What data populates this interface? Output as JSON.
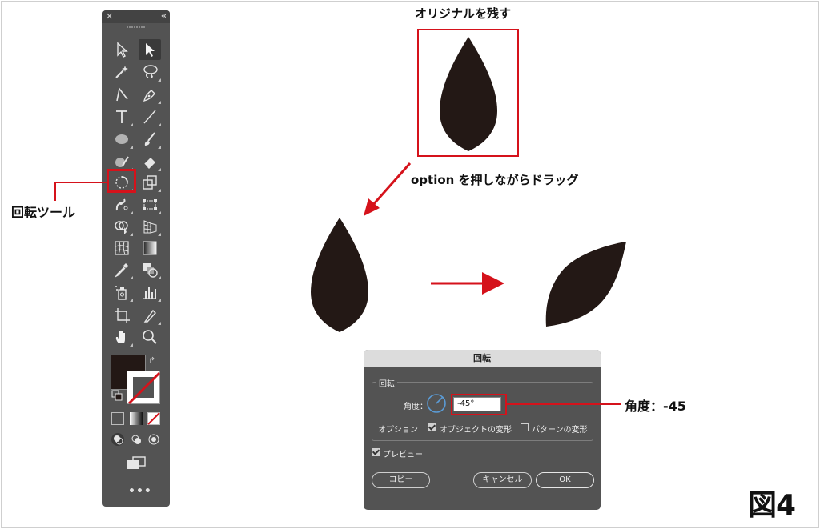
{
  "tools_panel": {
    "close_glyph": "✕",
    "collapse_glyph": "«",
    "more_glyph": "•••",
    "tools": [
      {
        "icon": "direct-selection-icon"
      },
      {
        "icon": "selection-icon"
      },
      {
        "icon": "magic-wand-icon"
      },
      {
        "icon": "lasso-icon"
      },
      {
        "icon": "curvature-icon"
      },
      {
        "icon": "pen-icon"
      },
      {
        "icon": "type-icon"
      },
      {
        "icon": "line-icon"
      },
      {
        "icon": "ellipse-icon"
      },
      {
        "icon": "paintbrush-icon"
      },
      {
        "icon": "shaper-icon"
      },
      {
        "icon": "eraser-icon"
      },
      {
        "icon": "rotate-icon"
      },
      {
        "icon": "scale-icon"
      },
      {
        "icon": "puppet-warp-icon"
      },
      {
        "icon": "free-transform-icon"
      },
      {
        "icon": "shape-builder-icon"
      },
      {
        "icon": "perspective-grid-icon"
      },
      {
        "icon": "mesh-icon"
      },
      {
        "icon": "gradient-icon"
      },
      {
        "icon": "eyedropper-icon"
      },
      {
        "icon": "blend-icon"
      },
      {
        "icon": "symbol-sprayer-icon"
      },
      {
        "icon": "column-graph-icon"
      },
      {
        "icon": "artboard-icon"
      },
      {
        "icon": "slice-icon"
      },
      {
        "icon": "hand-icon"
      },
      {
        "icon": "zoom-icon"
      }
    ],
    "fill_color": "#231815"
  },
  "callouts": {
    "rotate_tool": "回転ツール",
    "keep_original": "オリジナルを残す",
    "option_drag": "option を押しながらドラッグ",
    "angle": "角度：-45",
    "figure": "図4"
  },
  "dialog": {
    "title": "回転",
    "group_label": "回転",
    "angle_label": "角度：",
    "angle_value": "-45°",
    "options_label": "オプション",
    "objects_label": "オブジェクトの変形",
    "objects_checked": true,
    "patterns_label": "パターンの変形",
    "patterns_checked": false,
    "preview_label": "プレビュー",
    "preview_checked": true,
    "copy_button": "コピー",
    "cancel_button": "キャンセル",
    "ok_button": "OK"
  },
  "colors": {
    "accent_red": "#d5121b",
    "leaf": "#231815",
    "panel": "#535353"
  }
}
